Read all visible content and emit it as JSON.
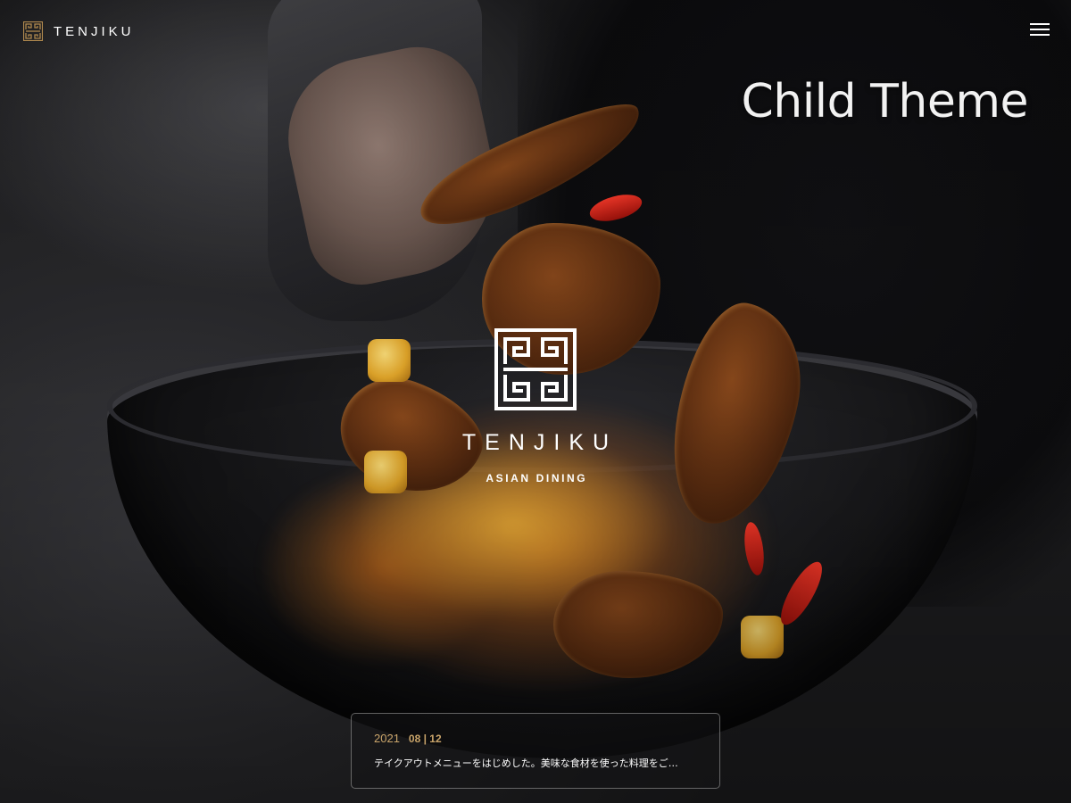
{
  "header": {
    "brand": "TENJIKU",
    "logo_icon": "tenjiku-meander-logo-icon",
    "menu_icon": "hamburger-menu-icon"
  },
  "theme_label": "Child Theme",
  "hero": {
    "brand": "TENJIKU",
    "tagline": "ASIAN DINING",
    "logo_icon": "tenjiku-meander-logo-icon"
  },
  "news": {
    "year": "2021",
    "month_day": "08 | 12",
    "excerpt": "テイクアウトメニューをはじめした。美味な食材を使った料理をご…"
  },
  "colors": {
    "accent_gold": "#c9a46a",
    "text": "#ffffff",
    "logo_gold": "#b0894e"
  }
}
